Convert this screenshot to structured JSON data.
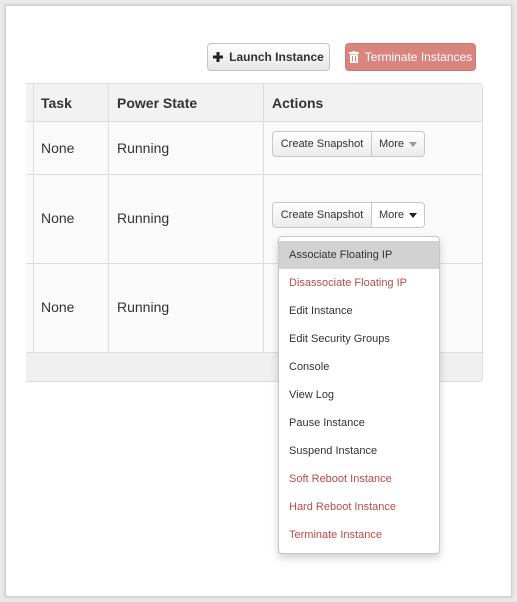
{
  "toolbar": {
    "launch_label": "Launch Instance",
    "terminate_label": "Terminate Instances"
  },
  "table": {
    "columns": [
      "Task",
      "Power State",
      "Actions"
    ],
    "rows": [
      {
        "task": "None",
        "power_state": "Running",
        "snapshot_label": "Create Snapshot",
        "more_label": "More"
      },
      {
        "task": "None",
        "power_state": "Running",
        "snapshot_label": "Create Snapshot",
        "more_label": "More"
      },
      {
        "task": "None",
        "power_state": "Running"
      }
    ]
  },
  "dropdown": {
    "items": [
      {
        "label": "Associate Floating IP",
        "style": "active"
      },
      {
        "label": "Disassociate Floating IP",
        "style": "danger"
      },
      {
        "label": "Edit Instance",
        "style": "normal"
      },
      {
        "label": "Edit Security Groups",
        "style": "normal"
      },
      {
        "label": "Console",
        "style": "normal"
      },
      {
        "label": "View Log",
        "style": "normal"
      },
      {
        "label": "Pause Instance",
        "style": "normal"
      },
      {
        "label": "Suspend Instance",
        "style": "normal"
      },
      {
        "label": "Soft Reboot Instance",
        "style": "danger"
      },
      {
        "label": "Hard Reboot Instance",
        "style": "danger"
      },
      {
        "label": "Terminate Instance",
        "style": "danger"
      }
    ]
  },
  "colors": {
    "danger_button": "#d9847d",
    "danger_text": "#b94a48",
    "active_item": "#d2d2d2"
  },
  "icons": {
    "launch": "plus-icon",
    "terminate": "trash-icon",
    "more": "caret-down-icon"
  }
}
